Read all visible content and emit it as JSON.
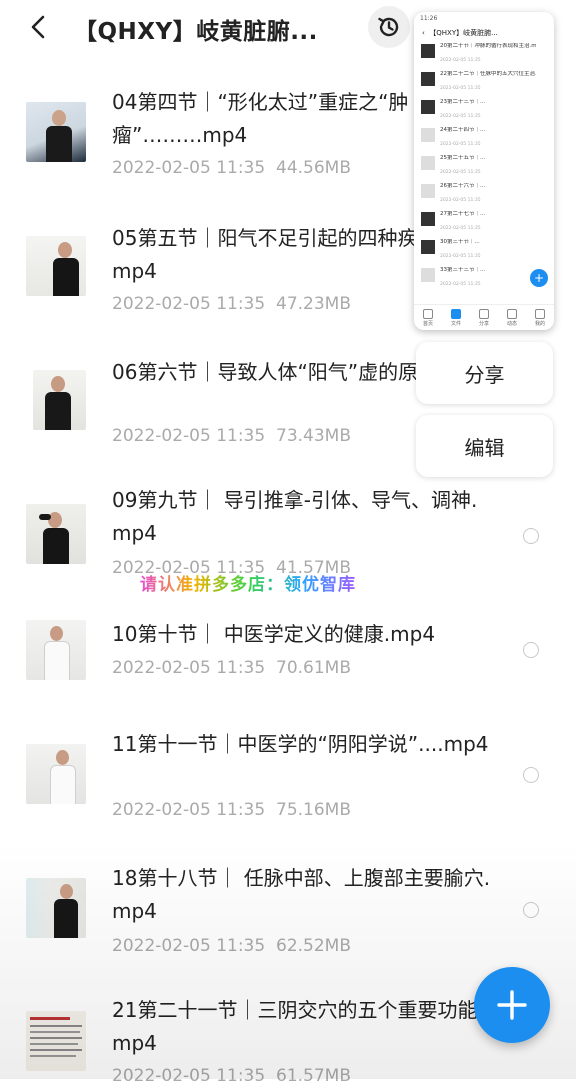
{
  "header": {
    "title": "【QHXY】岐黄脏腑..."
  },
  "files": [
    {
      "name": "04第四节｜“形化太过”重症之“肿瘤”………mp4",
      "date": "2022-02-05  11:35",
      "size": "44.56MB"
    },
    {
      "name": "05第五节｜阳气不足引起的四种疾病解析.mp4",
      "date": "2022-02-05  11:35",
      "size": "47.23MB"
    },
    {
      "name": "06第六节｜导致人体“阳气”虚的原.mp4",
      "date": "2022-02-05  11:35",
      "size": "73.43MB"
    },
    {
      "name": "09第九节｜ 导引推拿-引体、导气、调神.mp4",
      "date": "2022-02-05  11:35",
      "size": "41.57MB"
    },
    {
      "name": "10第十节｜ 中医学定义的健康.mp4",
      "date": "2022-02-05  11:35",
      "size": "70.61MB"
    },
    {
      "name": "11第十一节｜中医学的“阴阳学说”....mp4",
      "date": "2022-02-05  11:35",
      "size": "75.16MB"
    },
    {
      "name": "18第十八节｜ 任脉中部、上腹部主要腧穴.mp4",
      "date": "2022-02-05  11:35",
      "size": "62.52MB"
    },
    {
      "name": "21第二十一节｜三阴交穴的五个重要功能.mp4",
      "date": "2022-02-05  11:35",
      "size": "61.57MB"
    }
  ],
  "watermark": "请认准拼多多店：领优智库",
  "menu": {
    "share": "分享",
    "edit": "编辑"
  },
  "preview": {
    "status": "11:26",
    "title": "【QHXY】岐黄脏腑...",
    "rows": [
      {
        "name": "20第二十节｜冲脉的循行表现和主治.mp4",
        "meta": "2022-02-05  11:35"
      },
      {
        "name": "22第二十二节｜任脉中的五大穴位主治.mp4",
        "meta": "2022-02-05  11:35"
      },
      {
        "name": "23第二十三节｜...",
        "meta": "2022-02-05  11:35"
      },
      {
        "name": "24第二十四节｜...",
        "meta": "2022-02-05  11:35"
      },
      {
        "name": "25第二十五节｜...",
        "meta": "2022-02-05  11:35"
      },
      {
        "name": "26第二十六节｜...",
        "meta": "2022-02-05  11:35"
      },
      {
        "name": "27第二十七节｜...",
        "meta": "2022-02-05  11:35"
      },
      {
        "name": "30第三十节｜...",
        "meta": "2022-02-05  11:35"
      },
      {
        "name": "33第三十三节｜...",
        "meta": "2022-02-05  11:35"
      }
    ],
    "tabs": [
      "首页",
      "文件",
      "分享",
      "动态",
      "我的"
    ]
  }
}
